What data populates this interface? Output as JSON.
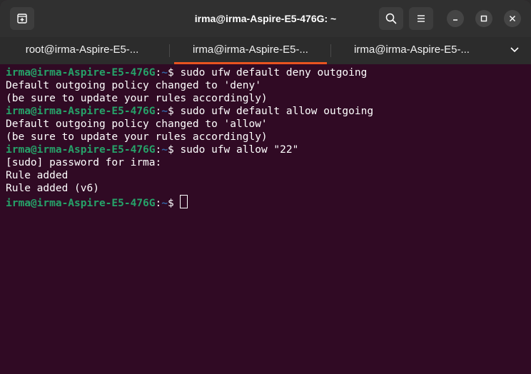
{
  "window": {
    "title": "irma@irma-Aspire-E5-476G: ~"
  },
  "tabs": [
    {
      "label": "root@irma-Aspire-E5-...",
      "active": false
    },
    {
      "label": "irma@irma-Aspire-E5-...",
      "active": true
    },
    {
      "label": "irma@irma-Aspire-E5-...",
      "active": false
    }
  ],
  "colors": {
    "terminal_bg": "#300a24",
    "prompt_user": "#26a269",
    "prompt_path": "#3465a4",
    "active_tab_accent": "#e95420"
  },
  "icons": {
    "new_tab": "new-tab-icon",
    "search": "search-icon",
    "menu": "hamburger-menu-icon",
    "minimize": "minimize-icon",
    "maximize": "maximize-icon",
    "close": "close-icon",
    "tab_list": "chevron-down-icon"
  },
  "terminal": {
    "prompt_user_host": "irma@irma-Aspire-E5-476G",
    "prompt_sep": ":",
    "prompt_path": "~",
    "prompt_symbol": "$ ",
    "lines": [
      {
        "type": "cmd",
        "text": "sudo ufw default deny outgoing"
      },
      {
        "type": "out",
        "text": "Default outgoing policy changed to 'deny'"
      },
      {
        "type": "out",
        "text": "(be sure to update your rules accordingly)"
      },
      {
        "type": "cmd",
        "text": "sudo ufw default allow outgoing"
      },
      {
        "type": "out",
        "text": "Default outgoing policy changed to 'allow'"
      },
      {
        "type": "out",
        "text": "(be sure to update your rules accordingly)"
      },
      {
        "type": "cmd",
        "text": "sudo ufw allow \"22\""
      },
      {
        "type": "out",
        "text": "[sudo] password for irma:"
      },
      {
        "type": "out",
        "text": "Rule added"
      },
      {
        "type": "out",
        "text": "Rule added (v6)"
      },
      {
        "type": "cmd",
        "text": ""
      }
    ]
  }
}
